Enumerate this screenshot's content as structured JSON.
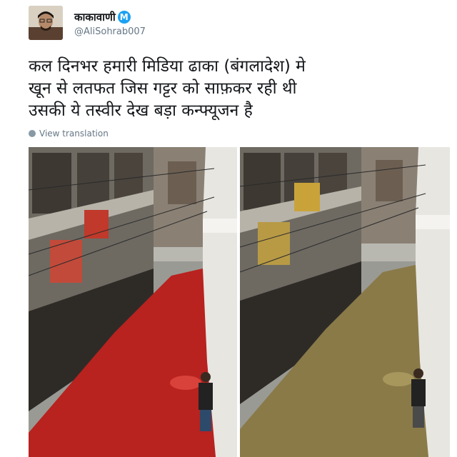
{
  "tweet": {
    "display_name": "काकावाणी",
    "verified_glyph": "M",
    "handle": "@AliSohrab007",
    "text_lines": [
      "कल दिनभर हमारी मिडिया ढाका (बंगलादेश) मे",
      "खून से लतफत जिस गट्टर को साफ़कर रही थी",
      "उसकी ये तस्वीर देख बड़ा कन्फ्यूजन है"
    ],
    "translate_link": "View translation",
    "photos": [
      {
        "water_color": "#b8221f",
        "water_highlight": "#d9423a"
      },
      {
        "water_color": "#8a7a48",
        "water_highlight": "#a8975d"
      }
    ]
  },
  "colors": {
    "verified_badge": "#1da1f2",
    "secondary_text": "#657786"
  }
}
